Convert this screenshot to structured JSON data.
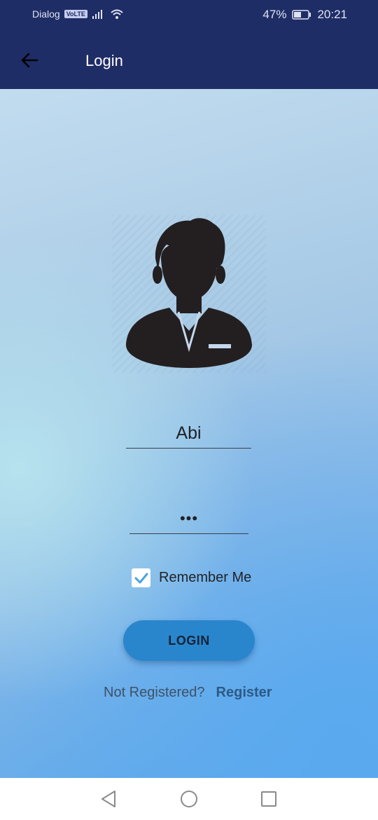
{
  "status_bar": {
    "carrier": "Dialog",
    "volte": "VoLTE",
    "battery": "47%",
    "time": "20:21"
  },
  "app_bar": {
    "title": "Login",
    "back_icon": "arrow-left-icon"
  },
  "form": {
    "username_value": "Abi",
    "password_value": "•••",
    "remember_label": "Remember Me",
    "remember_checked": true,
    "login_label": "LOGIN",
    "not_registered_text": "Not Registered?",
    "register_label": "Register"
  },
  "colors": {
    "app_bar": "#1f2d66",
    "button": "#2a86cc",
    "checkbox_check": "#4aa3df"
  },
  "nav_bar": {
    "icons": [
      "triangle-back-icon",
      "circle-home-icon",
      "square-recent-icon"
    ]
  }
}
